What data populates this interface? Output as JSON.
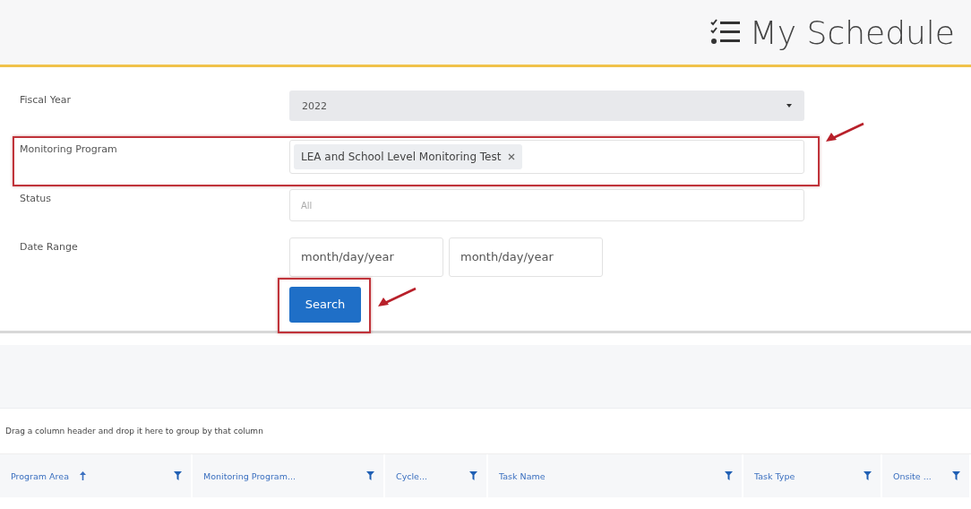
{
  "header": {
    "title": "My Schedule"
  },
  "filters": [
    {
      "kind": "select",
      "label": "Fiscal Year",
      "value": "2022",
      "highlighted": false
    },
    {
      "kind": "tags",
      "label": "Monitoring Program",
      "tags": [
        "LEA and School Level Monitoring Test"
      ],
      "highlighted": true
    },
    {
      "kind": "text",
      "label": "Status",
      "placeholder": "All",
      "highlighted": false
    },
    {
      "kind": "dates",
      "label": "Date Range",
      "placeholders": [
        "month/day/year",
        "month/day/year"
      ],
      "highlighted": false
    }
  ],
  "search_button": {
    "label": "Search",
    "highlighted": true
  },
  "grid": {
    "group_hint": "Drag a column header and drop it here to group by that column",
    "columns": [
      {
        "label": "Program Area",
        "sorted": true
      },
      {
        "label": "Monitoring Program...",
        "sorted": false
      },
      {
        "label": "Cycle...",
        "sorted": false
      },
      {
        "label": "Task Name",
        "sorted": false
      },
      {
        "label": "Task Type",
        "sorted": false
      },
      {
        "label": "Onsite ...",
        "sorted": false
      }
    ]
  }
}
